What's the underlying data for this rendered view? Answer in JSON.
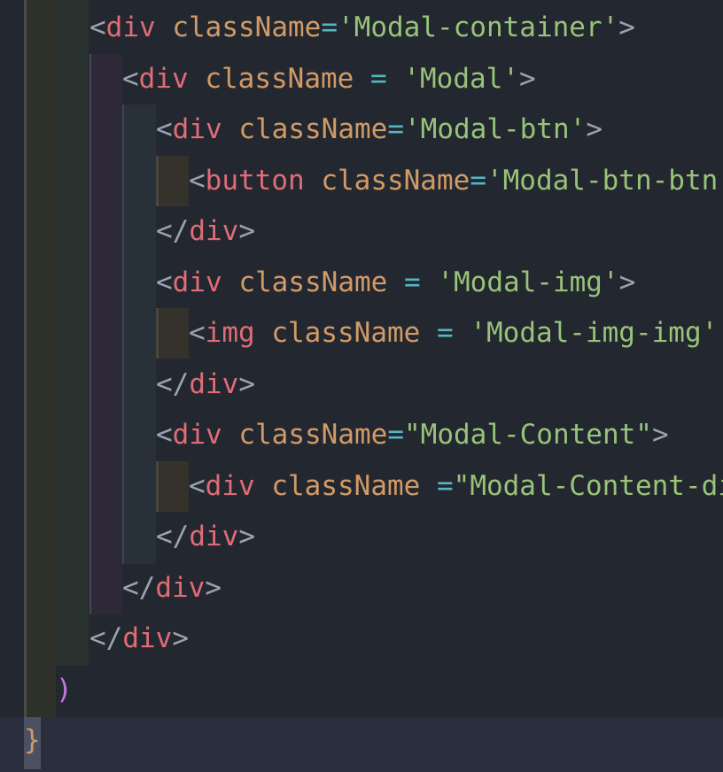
{
  "editor": {
    "lines": [
      {
        "lt": "<",
        "tag": "div",
        "attr": "className",
        "eq": "=",
        "val": "'Modal-container'",
        "gt": ">"
      },
      {
        "lt": "<",
        "tag": "div",
        "attr": "className",
        "eq": " = ",
        "val": "'Modal'",
        "gt": ">"
      },
      {
        "lt": "<",
        "tag": "div",
        "attr": "className",
        "eq": "=",
        "val": "'Modal-btn'",
        "gt": ">"
      },
      {
        "lt": "<",
        "tag": "button",
        "attr": "className",
        "eq": "=",
        "val": "'Modal-btn-btn",
        "gt": ""
      },
      {
        "lt": "</",
        "tag": "div",
        "gt": ">"
      },
      {
        "lt": "<",
        "tag": "div",
        "attr": "className",
        "eq": " = ",
        "val": "'Modal-img'",
        "gt": ">"
      },
      {
        "lt": "<",
        "tag": "img",
        "attr": "className",
        "eq": " = ",
        "val": "'Modal-img-img'",
        "gt": ""
      },
      {
        "lt": "</",
        "tag": "div",
        "gt": ">"
      },
      {
        "lt": "<",
        "tag": "div",
        "attr": "className",
        "eq": "=",
        "val": "\"Modal-Content\"",
        "gt": ">"
      },
      {
        "lt": "<",
        "tag": "div",
        "attr": "className",
        "eq": " =",
        "val": "\"Modal-Content-di",
        "gt": ""
      },
      {
        "lt": "</",
        "tag": "div",
        "gt": ">"
      },
      {
        "lt": "</",
        "tag": "div",
        "gt": ">"
      },
      {
        "lt": "</",
        "tag": "div",
        "gt": ">"
      }
    ],
    "paren": ")",
    "brace": "}"
  }
}
